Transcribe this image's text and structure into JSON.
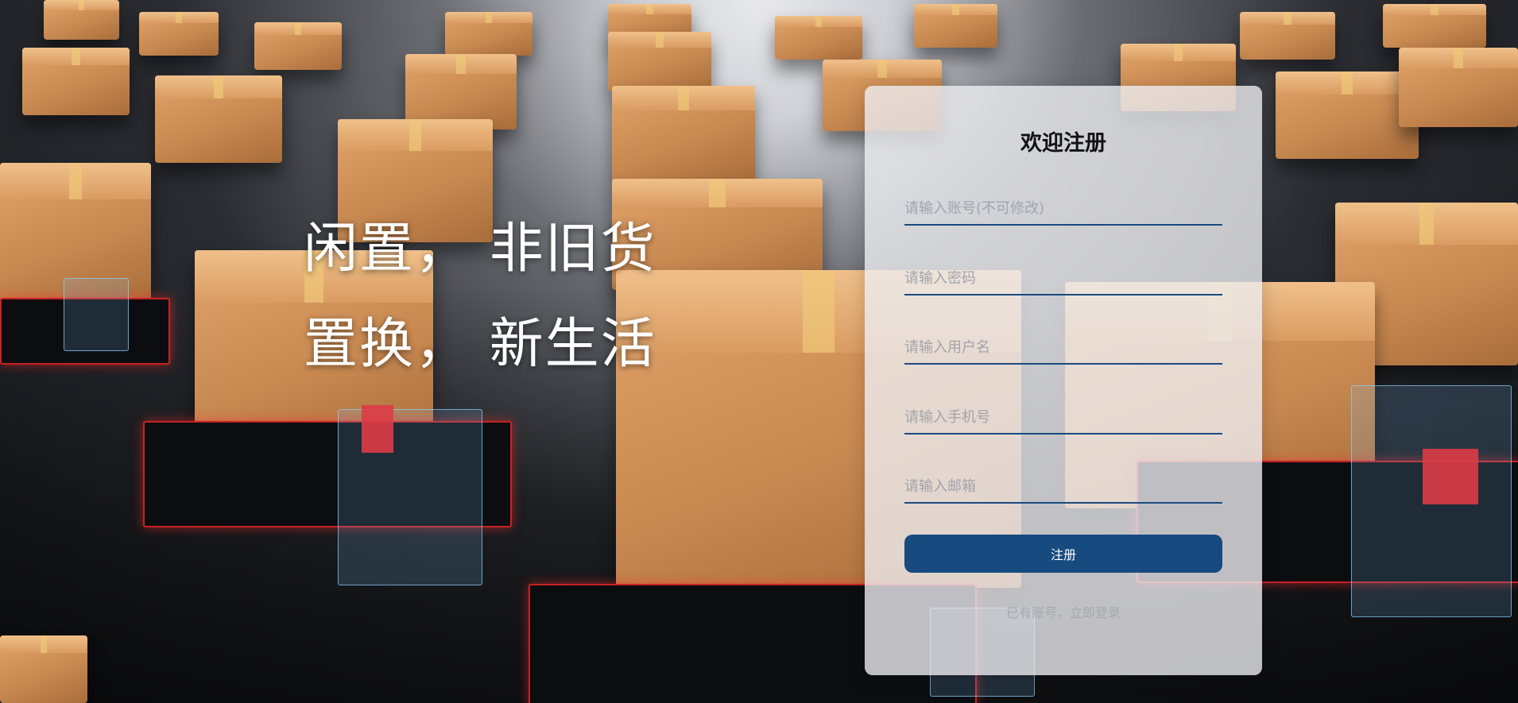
{
  "slogan": {
    "line1": "闲置， 非旧货",
    "line2": "置换， 新生活"
  },
  "register_form": {
    "title": "欢迎注册",
    "account_placeholder": "请输入账号(不可修改)",
    "password_placeholder": "请输入密码",
    "username_placeholder": "请输入用户名",
    "phone_placeholder": "请输入手机号",
    "email_placeholder": "请输入邮箱",
    "submit_label": "注册",
    "login_link": "已有账号，立即登录"
  },
  "colors": {
    "primary": "#174a7e",
    "card_background": "#ececf0",
    "placeholder_text": "#a2a4aa",
    "link_text": "#a6a8ad"
  }
}
